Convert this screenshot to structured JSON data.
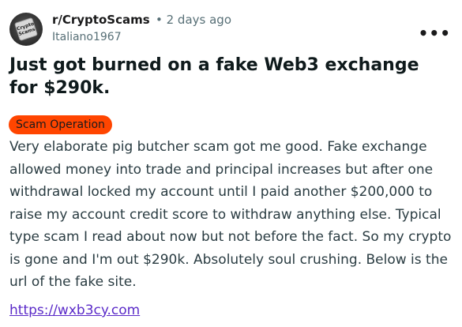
{
  "post": {
    "subreddit": "r/CryptoScams",
    "separator_time": "• 2 days ago",
    "author": "Italiano1967",
    "more_icon": "more-icon",
    "avatar_text": "Crypto Scams",
    "title": "Just got burned on a fake Web3 exchange for $290k.",
    "flair": "Scam Operation",
    "flair_color": "#ff4500",
    "body": "Very elaborate pig butcher scam got me good. Fake exchange allowed money into trade and principal increases but after one withdrawal locked my account until I paid another $200,000 to raise my account credit score to withdraw anything else. Typical type scam I read about now but not before the fact. So my crypto is gone and I'm out $290k. Absolutely soul crushing. Below is the url of the fake site.",
    "link": "https://wxb3cy.com"
  }
}
